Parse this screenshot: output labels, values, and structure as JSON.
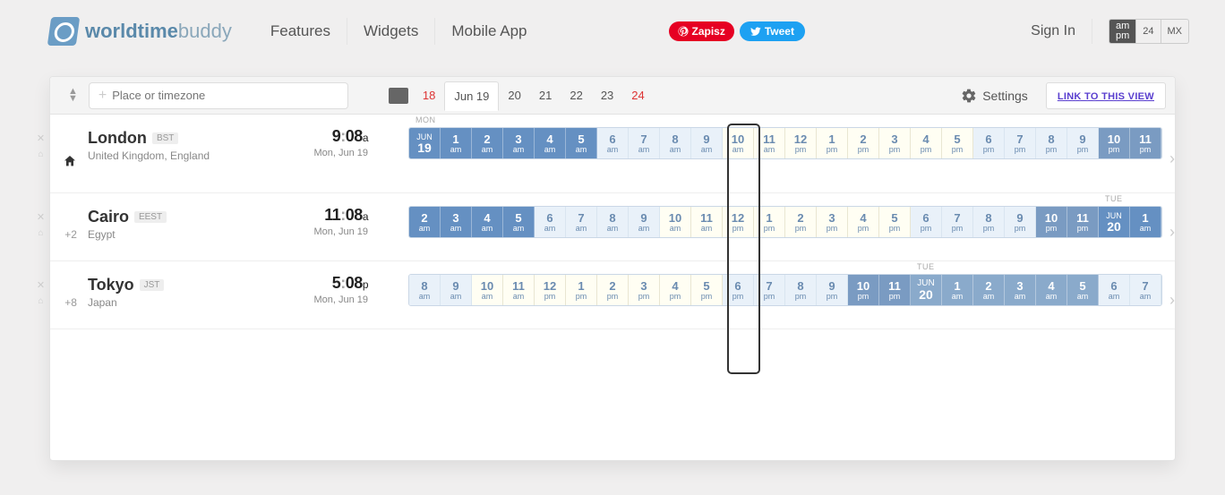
{
  "brand": {
    "name1": "worldtime",
    "name2": "buddy"
  },
  "nav": {
    "features": "Features",
    "widgets": "Widgets",
    "mobile": "Mobile App"
  },
  "social": {
    "pin": "Zapisz",
    "tweet": "Tweet"
  },
  "signin": "Sign In",
  "mode": {
    "ampm_top": "am",
    "ampm_bot": "pm",
    "h24": "24",
    "mx": "MX"
  },
  "search": {
    "placeholder": "Place or timezone"
  },
  "dates": {
    "d1": "18",
    "d2": "Jun 19",
    "d3": "20",
    "d4": "21",
    "d5": "22",
    "d6": "23",
    "d7": "24"
  },
  "settings": "Settings",
  "linkview": "LINK TO THIS VIEW",
  "labels": {
    "mon": "MON",
    "tue": "TUE"
  },
  "rows": [
    {
      "offset": "",
      "home": true,
      "city": "London",
      "tz": "BST",
      "sub": "United Kingdom, England",
      "time": "9:08",
      "ap": "a",
      "date": "Mon, Jun 19",
      "daylbl": {
        "pos": 0,
        "txt": "MON"
      },
      "cells": [
        {
          "t": "hdr",
          "m": "JUN",
          "d": "19"
        },
        {
          "t": "dk",
          "h": "1",
          "p": "am"
        },
        {
          "t": "dk",
          "h": "2",
          "p": "am"
        },
        {
          "t": "dk",
          "h": "3",
          "p": "am"
        },
        {
          "t": "dk",
          "h": "4",
          "p": "am"
        },
        {
          "t": "dk",
          "h": "5",
          "p": "am"
        },
        {
          "t": "lt",
          "h": "6",
          "p": "am"
        },
        {
          "t": "lt",
          "h": "7",
          "p": "am"
        },
        {
          "t": "lt",
          "h": "8",
          "p": "am"
        },
        {
          "t": "lt",
          "h": "9",
          "p": "am"
        },
        {
          "t": "vr",
          "h": "10",
          "p": "am"
        },
        {
          "t": "vr",
          "h": "11",
          "p": "am"
        },
        {
          "t": "vr",
          "h": "12",
          "p": "pm"
        },
        {
          "t": "vr",
          "h": "1",
          "p": "pm"
        },
        {
          "t": "vr",
          "h": "2",
          "p": "pm"
        },
        {
          "t": "vr",
          "h": "3",
          "p": "pm"
        },
        {
          "t": "vr",
          "h": "4",
          "p": "pm"
        },
        {
          "t": "vr",
          "h": "5",
          "p": "pm"
        },
        {
          "t": "lt",
          "h": "6",
          "p": "pm"
        },
        {
          "t": "lt",
          "h": "7",
          "p": "pm"
        },
        {
          "t": "lt",
          "h": "8",
          "p": "pm"
        },
        {
          "t": "lt",
          "h": "9",
          "p": "pm"
        },
        {
          "t": "dm",
          "h": "10",
          "p": "pm"
        },
        {
          "t": "dm",
          "h": "11",
          "p": "pm"
        }
      ]
    },
    {
      "offset": "+2",
      "city": "Cairo",
      "tz": "EEST",
      "sub": "Egypt",
      "time": "11:08",
      "ap": "a",
      "date": "Mon, Jun 19",
      "daylbl": {
        "pos": 22,
        "txt": "TUE"
      },
      "cells": [
        {
          "t": "dk",
          "h": "2",
          "p": "am"
        },
        {
          "t": "dk",
          "h": "3",
          "p": "am"
        },
        {
          "t": "dk",
          "h": "4",
          "p": "am"
        },
        {
          "t": "dk",
          "h": "5",
          "p": "am"
        },
        {
          "t": "lt",
          "h": "6",
          "p": "am"
        },
        {
          "t": "lt",
          "h": "7",
          "p": "am"
        },
        {
          "t": "lt",
          "h": "8",
          "p": "am"
        },
        {
          "t": "lt",
          "h": "9",
          "p": "am"
        },
        {
          "t": "vr",
          "h": "10",
          "p": "am"
        },
        {
          "t": "vr",
          "h": "11",
          "p": "am"
        },
        {
          "t": "vr",
          "h": "12",
          "p": "pm"
        },
        {
          "t": "vr",
          "h": "1",
          "p": "pm"
        },
        {
          "t": "vr",
          "h": "2",
          "p": "pm"
        },
        {
          "t": "vr",
          "h": "3",
          "p": "pm"
        },
        {
          "t": "vr",
          "h": "4",
          "p": "pm"
        },
        {
          "t": "vr",
          "h": "5",
          "p": "pm"
        },
        {
          "t": "lt",
          "h": "6",
          "p": "pm"
        },
        {
          "t": "lt",
          "h": "7",
          "p": "pm"
        },
        {
          "t": "lt",
          "h": "8",
          "p": "pm"
        },
        {
          "t": "lt",
          "h": "9",
          "p": "pm"
        },
        {
          "t": "dm",
          "h": "10",
          "p": "pm"
        },
        {
          "t": "dm",
          "h": "11",
          "p": "pm"
        },
        {
          "t": "hdr",
          "m": "JUN",
          "d": "20"
        },
        {
          "t": "dk",
          "h": "1",
          "p": "am"
        }
      ]
    },
    {
      "offset": "+8",
      "city": "Tokyo",
      "tz": "JST",
      "sub": "Japan",
      "time": "5:08",
      "ap": "p",
      "date": "Mon, Jun 19",
      "daylbl": {
        "pos": 16,
        "txt": "TUE"
      },
      "cells": [
        {
          "t": "lt",
          "h": "8",
          "p": "am"
        },
        {
          "t": "lt",
          "h": "9",
          "p": "am"
        },
        {
          "t": "vr",
          "h": "10",
          "p": "am"
        },
        {
          "t": "vr",
          "h": "11",
          "p": "am"
        },
        {
          "t": "vr",
          "h": "12",
          "p": "pm"
        },
        {
          "t": "vr",
          "h": "1",
          "p": "pm"
        },
        {
          "t": "vr",
          "h": "2",
          "p": "pm"
        },
        {
          "t": "vr",
          "h": "3",
          "p": "pm"
        },
        {
          "t": "vr",
          "h": "4",
          "p": "pm"
        },
        {
          "t": "vr",
          "h": "5",
          "p": "pm"
        },
        {
          "t": "lt",
          "h": "6",
          "p": "pm"
        },
        {
          "t": "lt",
          "h": "7",
          "p": "pm"
        },
        {
          "t": "lt",
          "h": "8",
          "p": "pm"
        },
        {
          "t": "lt",
          "h": "9",
          "p": "pm"
        },
        {
          "t": "dm",
          "h": "10",
          "p": "pm"
        },
        {
          "t": "dm",
          "h": "11",
          "p": "pm"
        },
        {
          "t": "mh",
          "m": "JUN",
          "d": "20"
        },
        {
          "t": "md",
          "h": "1",
          "p": "am"
        },
        {
          "t": "md",
          "h": "2",
          "p": "am"
        },
        {
          "t": "md",
          "h": "3",
          "p": "am"
        },
        {
          "t": "md",
          "h": "4",
          "p": "am"
        },
        {
          "t": "md",
          "h": "5",
          "p": "am"
        },
        {
          "t": "lt",
          "h": "6",
          "p": "am"
        },
        {
          "t": "lt",
          "h": "7",
          "p": "am"
        }
      ]
    }
  ]
}
